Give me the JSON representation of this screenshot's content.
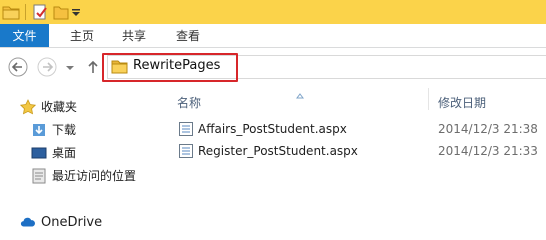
{
  "ribbon": {
    "file_tab": "文件",
    "tabs": [
      "主页",
      "共享",
      "查看"
    ]
  },
  "address": {
    "path": "RewritePages"
  },
  "nav": {
    "favorites": "收藏夹",
    "downloads": "下载",
    "desktop": "桌面",
    "recent": "最近访问的位置",
    "onedrive": "OneDrive"
  },
  "columns": {
    "name": "名称",
    "modified": "修改日期"
  },
  "files": [
    {
      "name": "Affairs_PostStudent.aspx",
      "date": "2014/12/3 21:38"
    },
    {
      "name": "Register_PostStudent.aspx",
      "date": "2014/12/3 21:33"
    }
  ],
  "colors": {
    "titlebar": "#fbd34a",
    "file_tab": "#1979ca",
    "highlight": "#d7262a"
  }
}
